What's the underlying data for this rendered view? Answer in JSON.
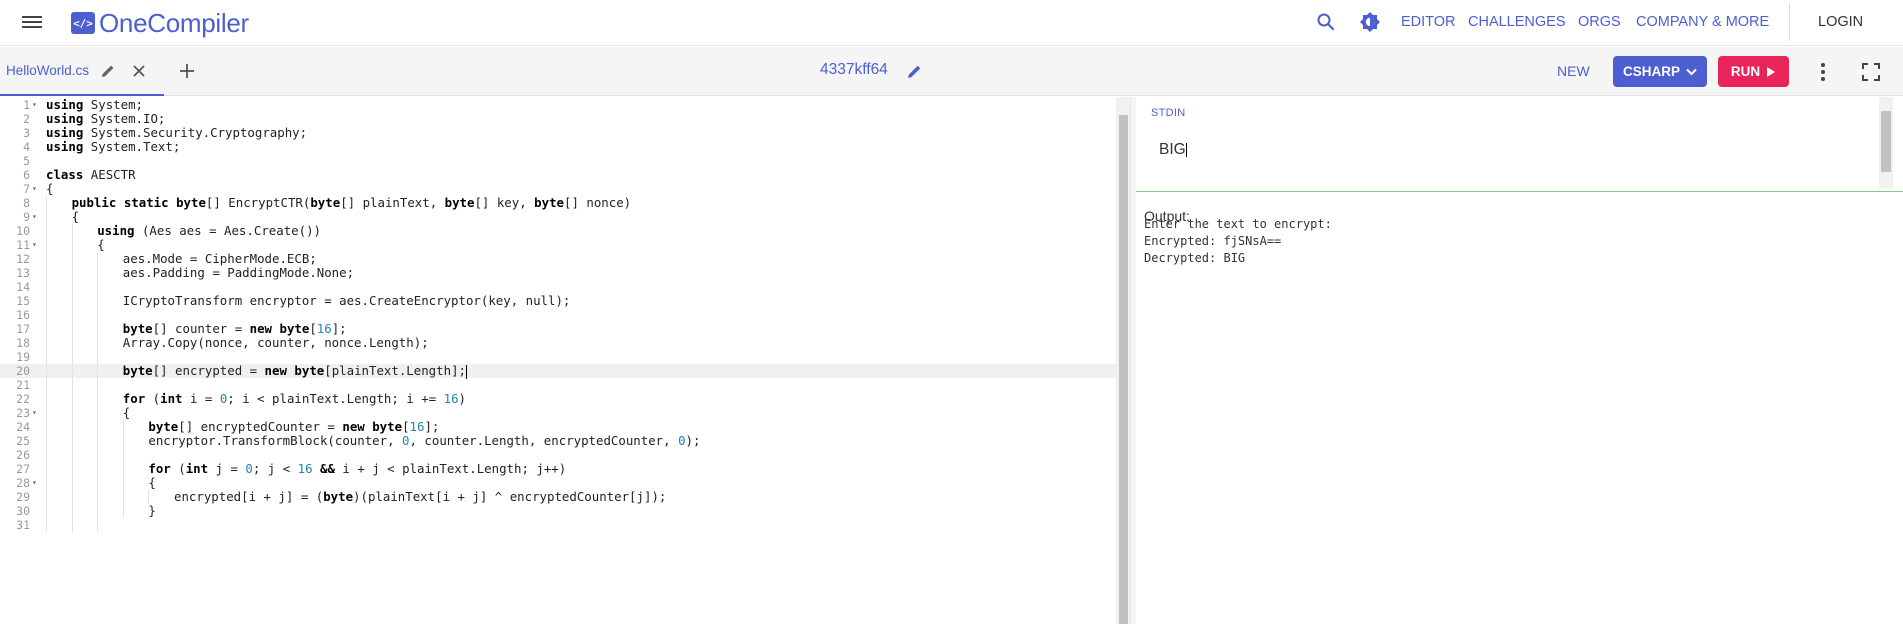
{
  "app": {
    "brand": "OneCompiler",
    "logo_mark": "</>",
    "accent_color": "#4b5fd1",
    "run_color": "#e8245b"
  },
  "nav": {
    "links": [
      "EDITOR",
      "CHALLENGES",
      "ORGS",
      "COMPANY & MORE"
    ],
    "login": "LOGIN",
    "icons": [
      "menu-icon",
      "search-icon",
      "theme-toggle-icon"
    ]
  },
  "toolbar": {
    "file_tab": "HelloWorld.cs",
    "doc_title": "4337kff64",
    "new_label": "NEW",
    "language": "CSHARP",
    "run_label": "RUN"
  },
  "editor": {
    "active_line": 20,
    "lines": [
      {
        "n": "1",
        "fold": true,
        "indent": 0,
        "code": "using System;"
      },
      {
        "n": "2",
        "fold": false,
        "indent": 0,
        "code": "using System.IO;"
      },
      {
        "n": "3",
        "fold": false,
        "indent": 0,
        "code": "using System.Security.Cryptography;"
      },
      {
        "n": "4",
        "fold": false,
        "indent": 0,
        "code": "using System.Text;"
      },
      {
        "n": "5",
        "fold": false,
        "indent": 0,
        "code": ""
      },
      {
        "n": "6",
        "fold": false,
        "indent": 0,
        "code": "class AESCTR"
      },
      {
        "n": "7",
        "fold": true,
        "indent": 0,
        "code": "{"
      },
      {
        "n": "8",
        "fold": false,
        "indent": 1,
        "code": "public static byte[] EncryptCTR(byte[] plainText, byte[] key, byte[] nonce)"
      },
      {
        "n": "9",
        "fold": true,
        "indent": 1,
        "code": "{"
      },
      {
        "n": "10",
        "fold": false,
        "indent": 2,
        "code": "using (Aes aes = Aes.Create())"
      },
      {
        "n": "11",
        "fold": true,
        "indent": 2,
        "code": "{"
      },
      {
        "n": "12",
        "fold": false,
        "indent": 3,
        "code": "aes.Mode = CipherMode.ECB;"
      },
      {
        "n": "13",
        "fold": false,
        "indent": 3,
        "code": "aes.Padding = PaddingMode.None;"
      },
      {
        "n": "14",
        "fold": false,
        "indent": 3,
        "code": ""
      },
      {
        "n": "15",
        "fold": false,
        "indent": 3,
        "code": "ICryptoTransform encryptor = aes.CreateEncryptor(key, null);"
      },
      {
        "n": "16",
        "fold": false,
        "indent": 3,
        "code": ""
      },
      {
        "n": "17",
        "fold": false,
        "indent": 3,
        "code": "byte[] counter = new byte[16];"
      },
      {
        "n": "18",
        "fold": false,
        "indent": 3,
        "code": "Array.Copy(nonce, counter, nonce.Length);"
      },
      {
        "n": "19",
        "fold": false,
        "indent": 3,
        "code": ""
      },
      {
        "n": "20",
        "fold": false,
        "indent": 3,
        "code": "byte[] encrypted = new byte[plainText.Length];"
      },
      {
        "n": "21",
        "fold": false,
        "indent": 3,
        "code": ""
      },
      {
        "n": "22",
        "fold": false,
        "indent": 3,
        "code": "for (int i = 0; i < plainText.Length; i += 16)"
      },
      {
        "n": "23",
        "fold": true,
        "indent": 3,
        "code": "{"
      },
      {
        "n": "24",
        "fold": false,
        "indent": 4,
        "code": "byte[] encryptedCounter = new byte[16];"
      },
      {
        "n": "25",
        "fold": false,
        "indent": 4,
        "code": "encryptor.TransformBlock(counter, 0, counter.Length, encryptedCounter, 0);"
      },
      {
        "n": "26",
        "fold": false,
        "indent": 4,
        "code": ""
      },
      {
        "n": "27",
        "fold": false,
        "indent": 4,
        "code": "for (int j = 0; j < 16 && i + j < plainText.Length; j++)"
      },
      {
        "n": "28",
        "fold": true,
        "indent": 4,
        "code": "{"
      },
      {
        "n": "29",
        "fold": false,
        "indent": 5,
        "code": "encrypted[i + j] = (byte)(plainText[i + j] ^ encryptedCounter[j]);"
      },
      {
        "n": "30",
        "fold": false,
        "indent": 4,
        "code": "}"
      },
      {
        "n": "31",
        "fold": false,
        "indent": 3,
        "code": ""
      }
    ]
  },
  "stdin": {
    "label": "STDIN",
    "value": "BIG"
  },
  "output": {
    "label": "Output:",
    "lines": [
      "Enter the text to encrypt:",
      "Encrypted: fjSNsA==",
      "Decrypted: BIG"
    ]
  }
}
